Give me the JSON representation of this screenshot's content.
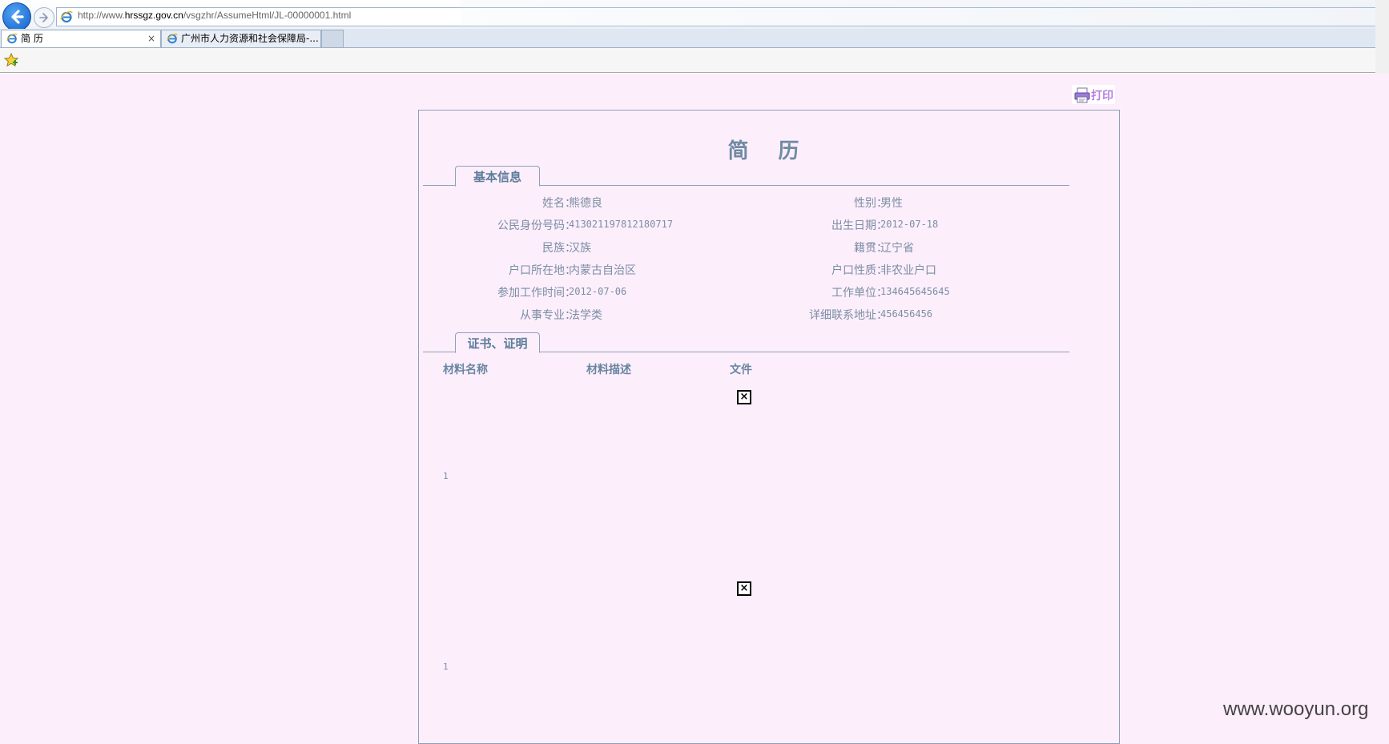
{
  "browser": {
    "url_prefix": "http://www.",
    "url_domain": "hrssgz.gov.cn",
    "url_path": "/vsgzhr/AssumeHtml/JL-00000001.html",
    "tabs": [
      {
        "label": "简 历",
        "close": "×"
      },
      {
        "label": "广州市人力资源和社会保障局-..."
      }
    ]
  },
  "toolbar": {
    "print_label": "打印"
  },
  "resume": {
    "title": "简  历",
    "basic_section": "基本信息",
    "fields_left": [
      {
        "label": "姓名：",
        "value": "熊德良"
      },
      {
        "label": "公民身份号码：",
        "value": "413021197812180717"
      },
      {
        "label": "民族：",
        "value": "汉族"
      },
      {
        "label": "户口所在地：",
        "value": "内蒙古自治区"
      },
      {
        "label": "参加工作时间：",
        "value": "2012-07-06"
      },
      {
        "label": "从事专业：",
        "value": "法学类"
      }
    ],
    "fields_right": [
      {
        "label": "性别：",
        "value": "男性"
      },
      {
        "label": "出生日期：",
        "value": "2012-07-18"
      },
      {
        "label": "籍贯：",
        "value": "辽宁省"
      },
      {
        "label": "户口性质：",
        "value": "非农业户口"
      },
      {
        "label": "工作单位：",
        "value": "134645645645"
      },
      {
        "label": "详细联系地址：",
        "value": "456456456"
      }
    ],
    "cert_section": "证书、证明",
    "cert_columns": [
      "材料名称",
      "材料描述",
      "文件"
    ],
    "cert_rows": [
      {
        "name": "1",
        "file_icon": "broken-image-icon"
      },
      {
        "name": "1",
        "file_icon": "broken-image-icon"
      }
    ]
  },
  "watermark": "www.wooyun.org",
  "colors": {
    "page_bg": "#fdeefc",
    "border": "#8e9fb4",
    "label_text": "#7a8ea3",
    "heading_text": "#6f8aa3",
    "print_text": "#b77ee0"
  }
}
